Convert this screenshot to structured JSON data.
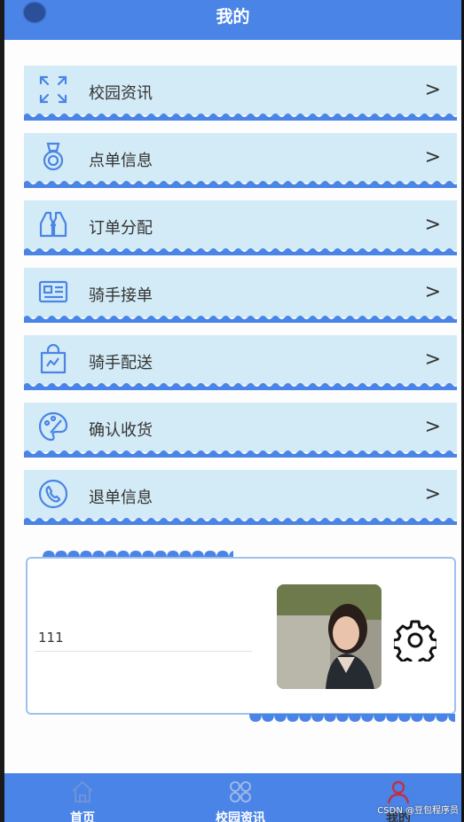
{
  "header": {
    "title": "我的"
  },
  "menu": [
    {
      "label": "校园资讯",
      "icon": "expand-icon"
    },
    {
      "label": "点单信息",
      "icon": "medal-icon"
    },
    {
      "label": "订单分配",
      "icon": "binoculars-icon"
    },
    {
      "label": "骑手接单",
      "icon": "id-card-icon"
    },
    {
      "label": "骑手配送",
      "icon": "shopping-bag-icon"
    },
    {
      "label": "确认收货",
      "icon": "palette-icon"
    },
    {
      "label": "退单信息",
      "icon": "phone-icon"
    }
  ],
  "chevron": ">",
  "profile": {
    "value": "111",
    "settings_icon": "gear-icon"
  },
  "tabbar": {
    "tabs": [
      {
        "label": "首页",
        "icon": "home-icon"
      },
      {
        "label": "校园资讯",
        "icon": "grid-icon"
      },
      {
        "label": "我的",
        "icon": "user-icon"
      }
    ]
  },
  "watermark": "CSDN @豆包程序员",
  "colors": {
    "primary": "#4a84e6",
    "item_bg": "#d3ebf6",
    "wave": "#4a84e6",
    "active_tab": "#c0304a"
  }
}
